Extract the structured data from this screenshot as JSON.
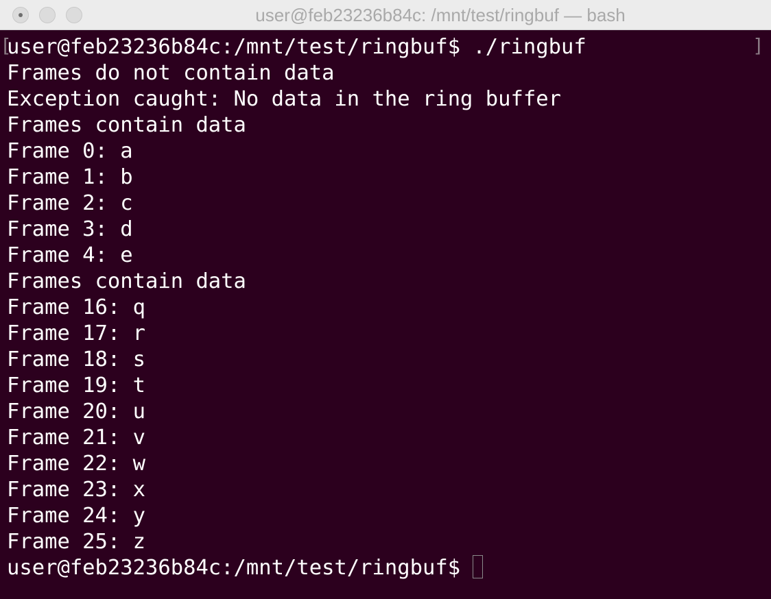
{
  "window": {
    "title": "user@feb23236b84c: /mnt/test/ringbuf — bash"
  },
  "terminal": {
    "prompt_command": "user@feb23236b84c:/mnt/test/ringbuf$ ./ringbuf",
    "output_lines": [
      "Frames do not contain data",
      "Exception caught: No data in the ring buffer",
      "Frames contain data",
      "Frame 0: a",
      "Frame 1: b",
      "Frame 2: c",
      "Frame 3: d",
      "Frame 4: e",
      "Frames contain data",
      "Frame 16: q",
      "Frame 17: r",
      "Frame 18: s",
      "Frame 19: t",
      "Frame 20: u",
      "Frame 21: v",
      "Frame 22: w",
      "Frame 23: x",
      "Frame 24: y",
      "Frame 25: z"
    ],
    "final_prompt": "user@feb23236b84c:/mnt/test/ringbuf$",
    "left_bracket": "[",
    "right_bracket": "]"
  },
  "colors": {
    "background": "#2c001e",
    "text": "#ffffff",
    "titlebar": "#ececec"
  }
}
